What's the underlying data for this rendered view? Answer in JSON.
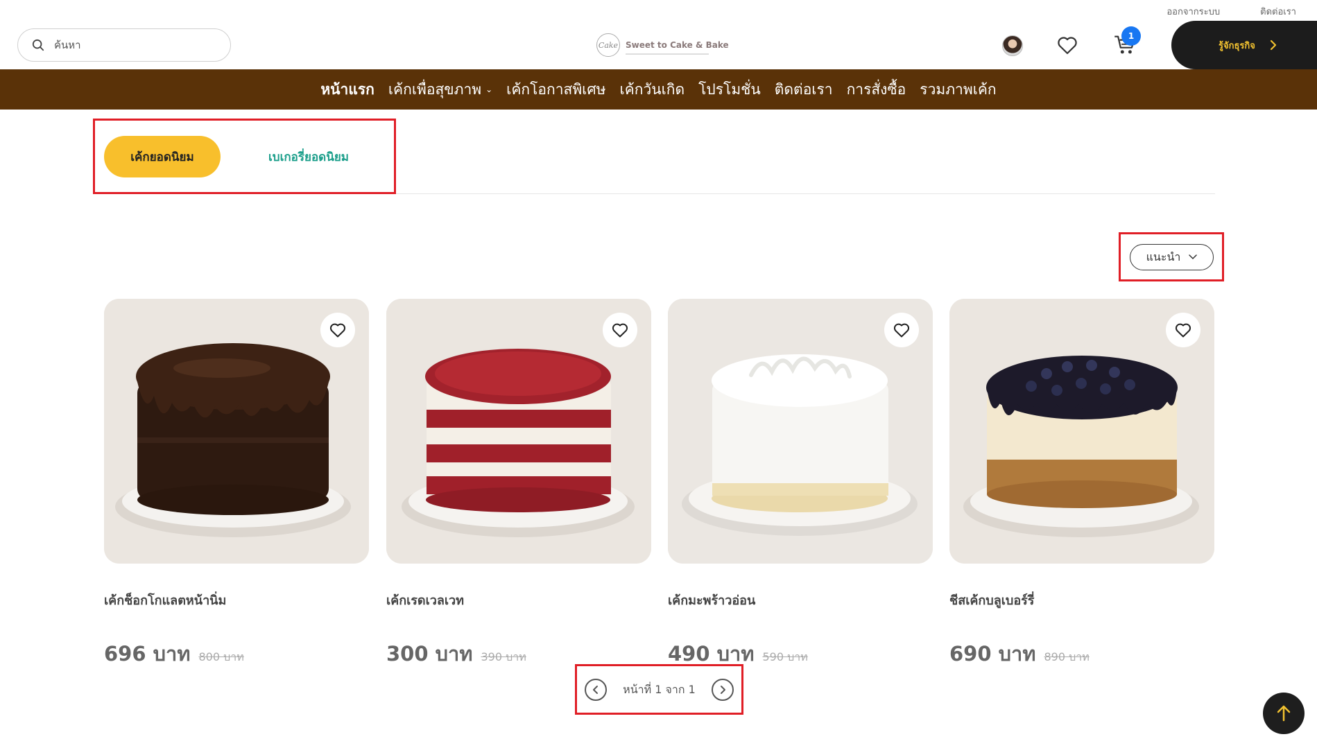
{
  "top_links": {
    "logout": "ออกจากระบบ",
    "contact": "ติดต่อเรา"
  },
  "search": {
    "placeholder": "ค้นหา",
    "value": ""
  },
  "logo": {
    "mark": "Cake",
    "name": "Sweet to Cake & Bake"
  },
  "cart": {
    "count": "1"
  },
  "cta": {
    "label": "รู้จักธุรกิจ"
  },
  "nav": {
    "items": [
      {
        "label": "หน้าแรก",
        "active": true
      },
      {
        "label": "เค้กเพื่อสุขภาพ",
        "has_dropdown": true
      },
      {
        "label": "เค้กโอกาสพิเศษ"
      },
      {
        "label": "เค้กวันเกิด"
      },
      {
        "label": "โปรโมชั่น"
      },
      {
        "label": "ติดต่อเรา"
      },
      {
        "label": "การสั่งซื้อ"
      },
      {
        "label": "รวมภาพเค้ก"
      }
    ]
  },
  "tabs": {
    "active": "เค้กยอดนิยม",
    "inactive": "เบเกอรี่ยอดนิยม"
  },
  "sort": {
    "selected": "แนะนำ"
  },
  "products": [
    {
      "name": "เค้กช็อกโกแลตหน้านิ่ม",
      "price": "696 บาท",
      "old_price": "800 บาท",
      "image": "chocolate-cake"
    },
    {
      "name": "เค้กเรดเวลเวท",
      "price": "300 บาท",
      "old_price": "390 บาท",
      "image": "red-velvet-cake"
    },
    {
      "name": "เค้กมะพร้าวอ่อน",
      "price": "490 บาท",
      "old_price": "590 บาท",
      "image": "coconut-cake"
    },
    {
      "name": "ชีสเค้กบลูเบอร์รี่",
      "price": "690 บาท",
      "old_price": "890 บาท",
      "image": "blueberry-cheesecake"
    }
  ],
  "pagination": {
    "text": "หน้าที่ 1 จาก 1"
  },
  "colors": {
    "nav_bg": "#5a3208",
    "accent_yellow": "#f8bf2c",
    "teal": "#1a9e8a",
    "annotation_red": "#e01e26",
    "badge_blue": "#1877f2"
  }
}
